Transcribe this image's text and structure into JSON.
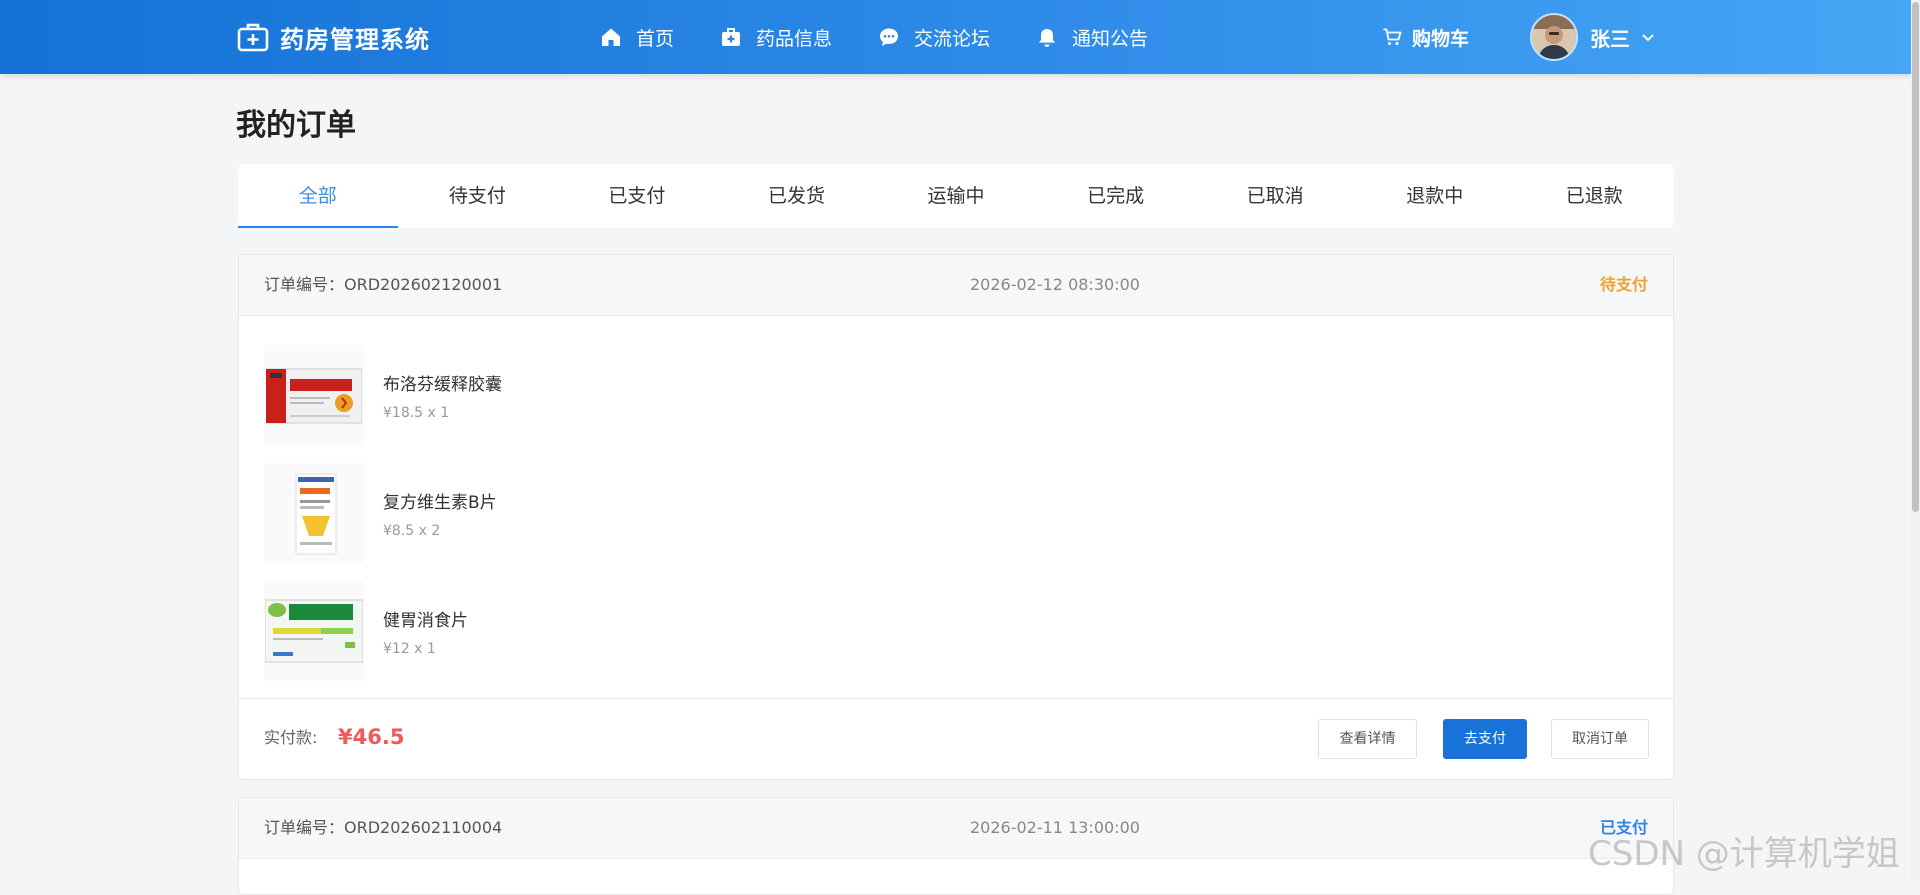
{
  "header": {
    "app_title": "药房管理系统",
    "nav": [
      {
        "label": "首页",
        "icon": "home-icon"
      },
      {
        "label": "药品信息",
        "icon": "medicine-kit-icon"
      },
      {
        "label": "交流论坛",
        "icon": "chat-bubble-icon"
      },
      {
        "label": "通知公告",
        "icon": "bell-icon"
      }
    ],
    "cart_label": "购物车",
    "user_name": "张三"
  },
  "page": {
    "title": "我的订单",
    "tabs": [
      "全部",
      "待支付",
      "已支付",
      "已发货",
      "运输中",
      "已完成",
      "已取消",
      "退款中",
      "已退款"
    ],
    "active_tab": "全部"
  },
  "orders": [
    {
      "order_no_label": "订单编号：ORD202602120001",
      "time": "2026-02-12 08:30:00",
      "status": "待支付",
      "status_color": "#f0a030",
      "items": [
        {
          "name": "布洛芬缓释胶囊",
          "price": "¥18.5 x 1"
        },
        {
          "name": "复方维生素B片",
          "price": "¥8.5 x 2"
        },
        {
          "name": "健胃消食片",
          "price": "¥12 x 1"
        }
      ],
      "paid_label": "实付款:",
      "paid_amount": "¥46.5",
      "actions": {
        "detail": "查看详情",
        "pay": "去支付",
        "cancel": "取消订单"
      }
    },
    {
      "order_no_label": "订单编号：ORD202602110004",
      "time": "2026-02-11 13:00:00",
      "status": "已支付",
      "status_color": "#2d84e2"
    }
  ],
  "watermark": "CSDN @计算机学姐",
  "colors": {
    "header_start": "#1472d6",
    "header_end": "#45a6f5",
    "accent": "#2d84e2",
    "primary_button": "#1872d8",
    "price_red": "#f05a5a"
  }
}
